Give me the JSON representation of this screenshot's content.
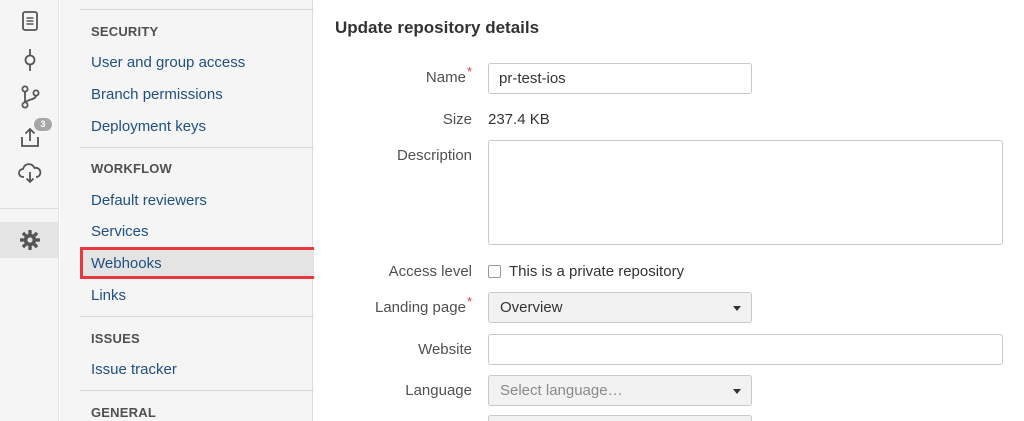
{
  "rail": {
    "icons": [
      "document-icon",
      "commit-icon",
      "branch-icon",
      "push-icon",
      "cloud-download-icon",
      "gear-icon"
    ],
    "push_badge": "3"
  },
  "nav": {
    "sections": [
      {
        "heading": "SECURITY",
        "items": [
          "User and group access",
          "Branch permissions",
          "Deployment keys"
        ]
      },
      {
        "heading": "WORKFLOW",
        "items": [
          "Default reviewers",
          "Services",
          "Webhooks",
          "Links"
        ]
      },
      {
        "heading": "ISSUES",
        "items": [
          "Issue tracker"
        ]
      },
      {
        "heading": "GENERAL",
        "items": []
      }
    ],
    "highlighted_item": "Webhooks"
  },
  "form": {
    "title": "Update repository details",
    "name_label": "Name",
    "name_value": "pr-test-ios",
    "size_label": "Size",
    "size_value": "237.4 KB",
    "description_label": "Description",
    "description_value": "",
    "access_label": "Access level",
    "private_checkbox_label": "This is a private repository",
    "private_checked": false,
    "landing_label": "Landing page",
    "landing_value": "Overview",
    "website_label": "Website",
    "website_value": "",
    "language_label": "Language",
    "language_placeholder": "Select language…",
    "required_marker": "*"
  },
  "colors": {
    "link": "#205081",
    "highlight_border": "#e8383d",
    "required": "#d04437"
  }
}
